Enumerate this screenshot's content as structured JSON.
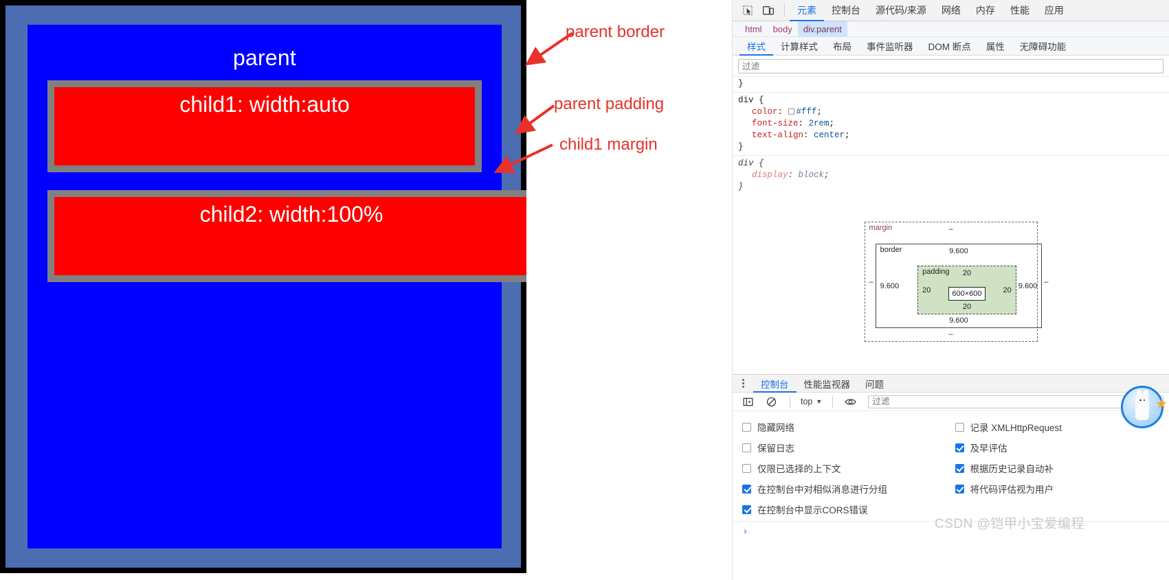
{
  "demo": {
    "parent_label": "parent",
    "child1_label": "child1: width:auto",
    "child2_label": "child2: width:100%",
    "colors": {
      "page_background": "#4d6db3",
      "parent_background": "#0000ff",
      "child_background": "#ff0000",
      "child_border": "#808080",
      "outer_frame": "#000000"
    }
  },
  "annotations": {
    "parent_border": "parent border",
    "parent_padding": "parent padding",
    "child1_margin": "child1 margin",
    "color": "#e8312a"
  },
  "devtools": {
    "toolbar": {
      "inspect_icon": "inspect-element-icon",
      "device_icon": "device-toolbar-icon",
      "tabs": [
        {
          "label": "元素",
          "active": true
        },
        {
          "label": "控制台",
          "active": false
        },
        {
          "label": "源代码/来源",
          "active": false
        },
        {
          "label": "网络",
          "active": false
        },
        {
          "label": "内存",
          "active": false
        },
        {
          "label": "性能",
          "active": false
        },
        {
          "label": "应用",
          "active": false
        }
      ]
    },
    "breadcrumbs": [
      {
        "label": "html",
        "selected": false
      },
      {
        "label": "body",
        "selected": false
      },
      {
        "label": "div.parent",
        "selected": true
      }
    ],
    "styles_tabs": [
      {
        "label": "样式",
        "active": true
      },
      {
        "label": "计算样式",
        "active": false
      },
      {
        "label": "布局",
        "active": false
      },
      {
        "label": "事件监听器",
        "active": false
      },
      {
        "label": "DOM 断点",
        "active": false
      },
      {
        "label": "属性",
        "active": false
      },
      {
        "label": "无障碍功能",
        "active": false
      }
    ],
    "filter_placeholder": "过滤",
    "css_rules": [
      {
        "closing_fragment": "}",
        "selector": "div {",
        "user_agent": false,
        "declarations": [
          {
            "property": "color",
            "value": "#fff",
            "swatch": "#ffffff"
          },
          {
            "property": "font-size",
            "value": "2rem",
            "swatch": null
          },
          {
            "property": "text-align",
            "value": "center",
            "swatch": null
          }
        ],
        "close": "}"
      },
      {
        "selector": "div {",
        "user_agent": true,
        "declarations": [
          {
            "property": "display",
            "value": "block",
            "swatch": null
          }
        ],
        "close": "}"
      }
    ],
    "box_model": {
      "margin_label": "margin",
      "margin_top": "–",
      "margin_right": "–",
      "margin_bottom": "–",
      "margin_left": "–",
      "border_label": "border",
      "border_top": "9.600",
      "border_right": "9.600",
      "border_bottom": "9.600",
      "border_left": "9.600",
      "padding_label": "padding",
      "padding_top": "20",
      "padding_right": "20",
      "padding_bottom": "20",
      "padding_left": "20",
      "content": "600×600"
    },
    "drawer": {
      "tabs": [
        {
          "label": "控制台",
          "active": true
        },
        {
          "label": "性能监视器",
          "active": false
        },
        {
          "label": "问题",
          "active": false
        }
      ],
      "sidebar_icon": "show-console-sidebar-icon",
      "clear_icon": "clear-console-icon",
      "context": "top",
      "eye_icon": "create-live-expression-icon",
      "filter_placeholder": "过滤",
      "settings": [
        {
          "label": "隐藏网络",
          "checked": false
        },
        {
          "label": "记录 XMLHttpRequest",
          "checked": false
        },
        {
          "label": "保留日志",
          "checked": false
        },
        {
          "label": "及早评估",
          "checked": true
        },
        {
          "label": "仅限已选择的上下文",
          "checked": false
        },
        {
          "label": "根据历史记录自动补",
          "checked": true
        },
        {
          "label": "在控制台中对相似消息进行分组",
          "checked": true
        },
        {
          "label": "将代码评估视为用户",
          "checked": true
        },
        {
          "label": "在控制台中显示CORS错误",
          "checked": true
        }
      ],
      "prompt": "›"
    }
  },
  "watermark": "CSDN @铠甲小宝爱编程"
}
